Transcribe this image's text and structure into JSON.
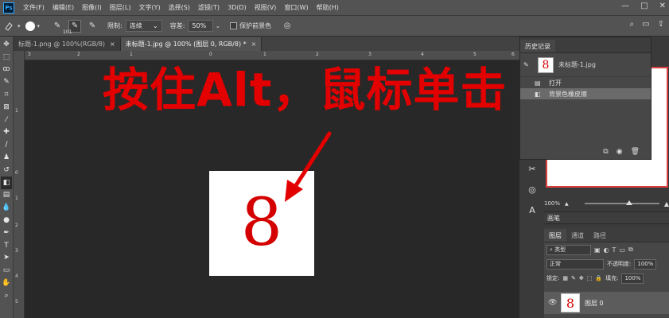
{
  "app": {
    "logo": "Ps"
  },
  "menubar": {
    "items": [
      "文件(F)",
      "编辑(E)",
      "图像(I)",
      "图层(L)",
      "文字(Y)",
      "选择(S)",
      "滤镜(T)",
      "3D(D)",
      "视图(V)",
      "窗口(W)",
      "帮助(H)"
    ],
    "window_controls": [
      "—",
      "□",
      "✕"
    ]
  },
  "options": {
    "brush_size": "101",
    "mode_label": "限制:",
    "mode_value": "连续",
    "tolerance_label": "容差:",
    "tolerance_value": "50%",
    "protect_label": "保护前景色"
  },
  "tabs": [
    {
      "label": "标题-1.png @ 100%(RGB/8)",
      "close": "×"
    },
    {
      "label": "未标题-1.jpg @ 100% (图层 0, RGB/8) *",
      "close": "×"
    }
  ],
  "rulers": {
    "h": [
      "3",
      "2",
      "1",
      "0",
      "1",
      "2",
      "3",
      "4",
      "5",
      "6"
    ],
    "v": [
      "1",
      "0",
      "1",
      "2",
      "3",
      "4",
      "5",
      "6",
      "7"
    ]
  },
  "canvas": {
    "annotation": "按住Alt，鼠标单击",
    "digit": "8"
  },
  "history": {
    "tab": "历史记录",
    "snapshot_label": "未标题-1.jpg",
    "snapshot_thumb": "8",
    "steps": [
      {
        "label": "打开",
        "selected": false
      },
      {
        "label": "背景色橡皮擦",
        "selected": true
      }
    ]
  },
  "navigator": {
    "zoom": "100%"
  },
  "brush_panel": {
    "title": "画笔"
  },
  "layers": {
    "tabs": [
      "图层",
      "通道",
      "路径"
    ],
    "filter": "类型",
    "blend_mode": "正常",
    "opacity_label": "不透明度:",
    "opacity_value": "100%",
    "lock_label": "锁定:",
    "fill_label": "填充:",
    "fill_value": "100%",
    "layer_name": "图层 0",
    "layer_thumb": "8"
  },
  "colors": {
    "annotation": "#e30000",
    "digit": "#d40000",
    "panel": "#474747"
  }
}
